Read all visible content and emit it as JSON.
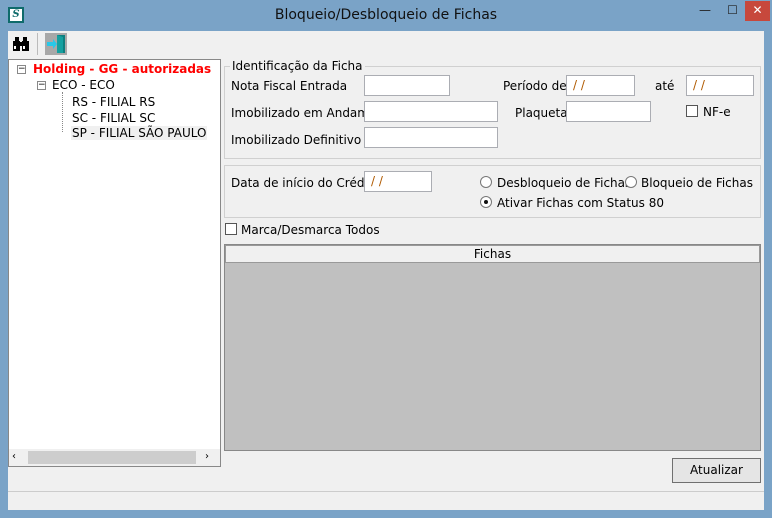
{
  "window": {
    "title": "Bloqueio/Desbloqueio de Fichas",
    "app_icon": "S",
    "minimize": "—",
    "maximize": "☐",
    "close": "✕"
  },
  "toolbar": {
    "icons": [
      "binoculars-icon",
      "exit-door-icon"
    ]
  },
  "tree": {
    "root": "Holding -  GG -  autorizadas",
    "root_color": "#ff0000",
    "child": "ECO - ECO",
    "leaves": [
      "RS - FILIAL RS",
      "SC - FILIAL SC",
      "SP - FILIAL SÃO PAULO"
    ],
    "expand": "−"
  },
  "identificacao": {
    "legend": "Identificação da Ficha",
    "nota_label": "Nota Fiscal Entrada",
    "nota_value": "",
    "andamento_label": "Imobilizado em Andamento",
    "andamento_value": "",
    "definitivo_label": "Imobilizado Definitivo",
    "definitivo_value": "",
    "periodo_label": "Período de",
    "periodo_value": " / /",
    "ate_label": "até",
    "ate_value": " / /",
    "plaqueta_label": "Plaqueta",
    "plaqueta_value": "",
    "nfe_label": "NF-e",
    "nfe_checked": false
  },
  "credito": {
    "label": "Data de início do Crédito",
    "value": " / /",
    "radios": [
      {
        "label": "Desbloqueio de Fichas",
        "checked": false
      },
      {
        "label": "Bloqueio de Fichas",
        "checked": false
      },
      {
        "label": "Ativar Fichas com Status 80",
        "checked": true
      }
    ]
  },
  "marca": {
    "label": "Marca/Desmarca Todos",
    "checked": false
  },
  "grid": {
    "header": "Fichas"
  },
  "actions": {
    "atualizar": "Atualizar"
  }
}
